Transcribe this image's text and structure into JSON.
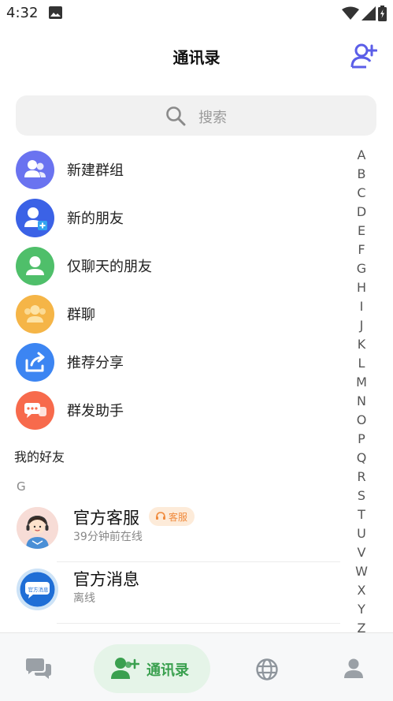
{
  "status_bar": {
    "time": "4:32"
  },
  "header": {
    "title": "通讯录"
  },
  "search": {
    "placeholder": "搜索"
  },
  "functions": [
    {
      "label": "新建群组",
      "icon": "group-icon",
      "color": "#6a73f0"
    },
    {
      "label": "新的朋友",
      "icon": "add-person-icon",
      "color": "#3b62e6"
    },
    {
      "label": "仅聊天的朋友",
      "icon": "person-icon",
      "color": "#4fbf6a"
    },
    {
      "label": "群聊",
      "icon": "group-chat-icon",
      "color": "#f5b547"
    },
    {
      "label": "推荐分享",
      "icon": "share-icon",
      "color": "#3c85f2"
    },
    {
      "label": "群发助手",
      "icon": "broadcast-icon",
      "color": "#f76a4c"
    }
  ],
  "friends_section": {
    "title": "我的好友",
    "letter": "G"
  },
  "contacts": [
    {
      "name": "官方客服",
      "status": "39分钟前在线",
      "badge": "客服",
      "avatar": "support-avatar"
    },
    {
      "name": "官方消息",
      "status": "离线",
      "avatar_text": "官方消息"
    }
  ],
  "alphabet": [
    "A",
    "B",
    "C",
    "D",
    "E",
    "F",
    "G",
    "H",
    "I",
    "J",
    "K",
    "L",
    "M",
    "N",
    "O",
    "P",
    "Q",
    "R",
    "S",
    "T",
    "U",
    "V",
    "W",
    "X",
    "Y",
    "Z"
  ],
  "bottom_nav": {
    "items": [
      {
        "name": "chats",
        "icon": "chat-bubbles-icon"
      },
      {
        "name": "contacts",
        "icon": "add-contact-icon",
        "label": "通讯录",
        "active": true
      },
      {
        "name": "discover",
        "icon": "globe-icon"
      },
      {
        "name": "me",
        "icon": "person-icon"
      }
    ]
  },
  "colors": {
    "accent": "#3aa04f",
    "header_icon": "#5b5ee8"
  }
}
